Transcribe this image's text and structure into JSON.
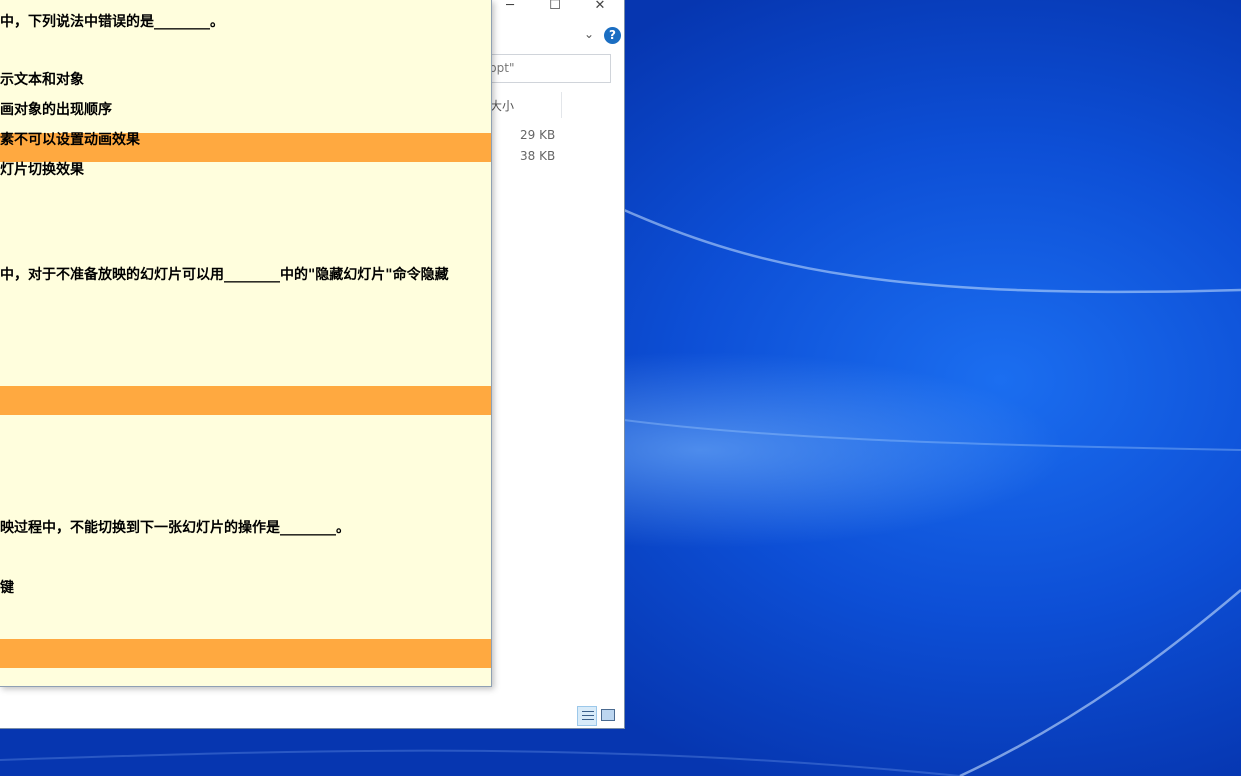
{
  "explorer": {
    "window_controls": {
      "minimize": "─",
      "maximize": "☐",
      "close": "✕"
    },
    "ribbon_toggle": "⌄",
    "help": "?",
    "search_text": "ppt\"",
    "column_size_label": "大小",
    "file_sizes": [
      "29 KB",
      "38 KB"
    ]
  },
  "document": {
    "lines": [
      "中，下列说法中错误的是________。",
      "示文本和对象",
      "画对象的出现顺序",
      "素不可以设置动画效果",
      "灯片切换效果",
      "中，对于不准备放映的幻灯片可以用________中的\"隐藏幻灯片\"命令隐藏",
      "映过程中，不能切换到下一张幻灯片的操作是________。",
      "键"
    ],
    "highlight_color": "#ffa940",
    "background_color": "#fffedd"
  },
  "desktop": {
    "wallpaper_color": "#0a3fc4"
  }
}
